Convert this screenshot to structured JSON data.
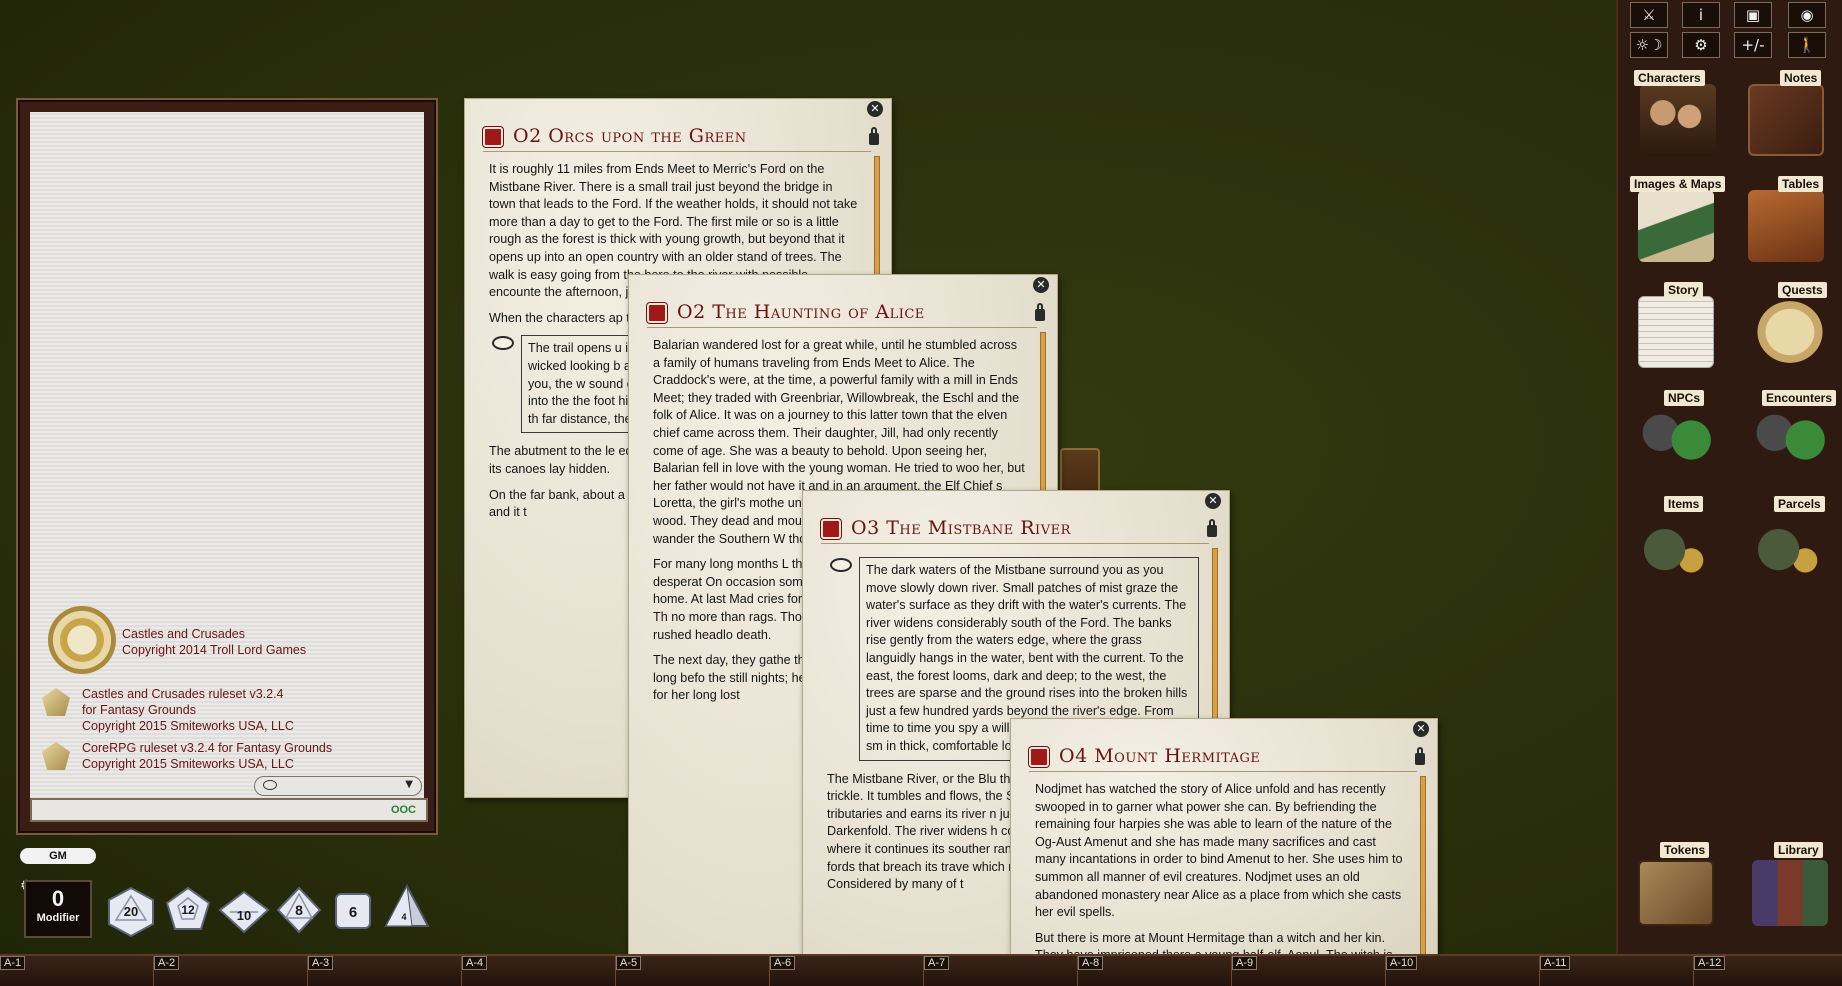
{
  "chat": {
    "entries": [
      {
        "line1": "Castles and Crusades",
        "line2": "Copyright 2014 Troll Lord Games"
      },
      {
        "line1": "Castles and Crusades ruleset v3.2.4",
        "line2": "for Fantasy Grounds",
        "line3": "Copyright 2015 Smiteworks USA, LLC"
      },
      {
        "line1": "CoreRPG ruleset v3.2.4 for Fantasy Grounds",
        "line2": "Copyright 2015 Smiteworks USA, LLC"
      }
    ],
    "ooc_label": "OOC"
  },
  "gm_label": "GM",
  "modifier": {
    "value": "0",
    "label": "Modifier"
  },
  "dice": [
    "20",
    "12",
    "10",
    "8",
    "6",
    "4"
  ],
  "toolbar": {
    "row1": [
      "⚔",
      "i",
      "▣",
      "◉"
    ],
    "row2": [
      "☼☽",
      "⚙",
      "+/-",
      "🚶"
    ]
  },
  "sidebar": {
    "characters": "Characters",
    "notes": "Notes",
    "images_maps": "Images & Maps",
    "tables": "Tables",
    "story": "Story",
    "quests": "Quests",
    "npcs": "NPCs",
    "encounters": "Encounters",
    "items": "Items",
    "parcels": "Parcels",
    "tokens": "Tokens",
    "library": "Library"
  },
  "hotkeys": [
    "A-1",
    "A-2",
    "A-3",
    "A-4",
    "A-5",
    "A-6",
    "A-7",
    "A-8",
    "A-9",
    "A-10",
    "A-11",
    "A-12"
  ],
  "windows": {
    "w1": {
      "title": "O2 Orcs upon the Green",
      "p1": "It is roughly 11 miles from Ends Meet to Merric's Ford on the Mistbane River. There is a small trail just beyond the bridge in town that leads to the Ford. If the weather holds, it should not take more than a day to get to the Ford. The first mile or so is a little rough as the forest is thick with young growth, but beyond that it opens up into an open country with an older stand of trees. The walk is easy going from the here to the river with possible encounte the afternoon, just as th",
      "p2": "When the characters ap text.",
      "box": "The trail opens u its glory. To your to rise in a small t wicked looking b and in front of yo trees marking th Below you, the w sound or fury, on Beyond the 100 f suddenly into the the foot hills of t is poor and rocky black jack oaks, th far distance, thes horizon.",
      "p3": "The abutment to the le edge, the undergrowth abutment and down its canoes lay hidden.",
      "p4": "On the far bank, about a beneath some bramble are well hidden and it t"
    },
    "w2": {
      "title": "O2 The Haunting of Alice",
      "p1": "Balarian wandered lost for a great while, until he stumbled across a family of humans traveling from Ends Meet to Alice. The Craddock's were, at the time, a powerful family with a mill in Ends Meet; they traded with Greenbriar, Willowbreak, the Eschl and the folk of Alice. It was on a journey to this latter town that the elven chief came across them. Their daughter, Jill, had only recently come of age. She was a beauty to behold. Upon seeing her, Balarian fell in love with the young woman. He tried to woo her, but her father would not have it and in an argument, the Elf Chief s Loretta, the girl's mothe until he vanished, leavin alone in the wood. They dead and mourn the loss Loretta and eventually s wander the Southern W though she found no sig",
      "p2": "For many long months L the wood. Travelers on t voice, filled with desperat On occasion someone w through the trees, callin come home. At last Mad cries for Jill carried throu whole village to arms. Th no more than rags. Thos to calm her but could no upon, she rushed headlo death.",
      "p3": "The next day, they gathe the cemetery at the aba But it was not long befo the still nights; her restl dead and wandered the looking for her long lost"
    },
    "w3": {
      "title": "O3 The Mistbane River",
      "box": "The dark waters of the Mistbane surround you as you move slowly down river. Small patches of mist graze the water's surface as they drift with the water's currents. The river widens considerably south of the Ford. The banks rise gently from the waters edge, where the grass languidly hangs in the water, bent with the current. To the east, the forest looms, dark and deep; to the west, the trees are sparse and the ground rises into the broken hills just a few hundred yards beyond the river's edge. From time to time you spy a willow tree standing alone upon a sm in thick, comfortable loo",
      "p1": "The Mistbane River, or the Blu the far Rhodope Mountains w a trickle. It tumbles and flows, the Shelves of the Mist, where tributaries and earns its river n just north and east of the sma Darkenfold. The river widens h considerably, drifting down be where it continues its souther ranges from 80-120 feet wide, few fords that breach its trave which reduce visibility conside flow. Considered by many of t"
    },
    "w4": {
      "title": "O4 Mount Hermitage",
      "p1": "Nodjmet has watched the story of Alice unfold and has recently swooped in to garner what power she can. By befriending the remaining four harpies she was able to learn of the nature of the Og-Aust Amenut and she has made many sacrifices and cast many incantations in order to bind Amenut to her. She uses him to summon all manner of evil creatures. Nodjmet uses an old abandoned monastery near Alice as a place from which she casts her evil spells.",
      "p2": "But there is more at Mount Hermitage than a witch and her kin. They have imprisoned there a young half-elf, Aenul. The witch is attempting to broker a sale of the prisoner to either the Bowlgaar or the elves. She frequents the Monastry often,"
    }
  }
}
